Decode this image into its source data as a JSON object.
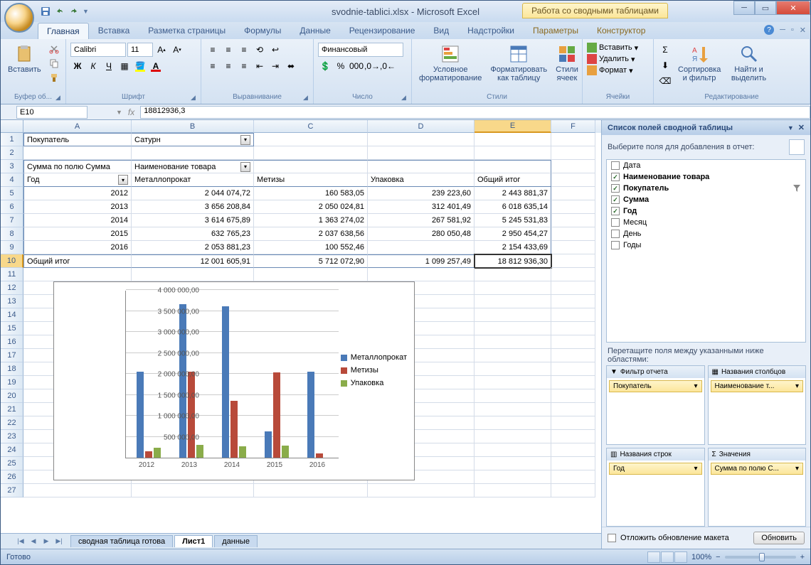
{
  "window": {
    "title": "svodnie-tablici.xlsx - Microsoft Excel",
    "context_tab": "Работа со сводными таблицами"
  },
  "tabs": {
    "home": "Главная",
    "insert": "Вставка",
    "page_layout": "Разметка страницы",
    "formulas": "Формулы",
    "data": "Данные",
    "review": "Рецензирование",
    "view": "Вид",
    "addins": "Надстройки",
    "options": "Параметры",
    "design": "Конструктор"
  },
  "ribbon": {
    "clipboard": {
      "label": "Буфер об...",
      "paste": "Вставить"
    },
    "font": {
      "label": "Шрифт",
      "name": "Calibri",
      "size": "11"
    },
    "alignment": {
      "label": "Выравнивание"
    },
    "number": {
      "label": "Число",
      "format": "Финансовый"
    },
    "styles": {
      "label": "Стили",
      "conditional": "Условное форматирование",
      "format_table": "Форматировать как таблицу",
      "cell_styles": "Стили ячеек"
    },
    "cells": {
      "label": "Ячейки",
      "insert": "Вставить",
      "delete": "Удалить",
      "format": "Формат"
    },
    "editing": {
      "label": "Редактирование",
      "sort": "Сортировка и фильтр",
      "find": "Найти и выделить"
    }
  },
  "formula_bar": {
    "name_box": "E10",
    "formula": "18812936,3"
  },
  "columns": [
    "A",
    "B",
    "C",
    "D",
    "E",
    "F"
  ],
  "pivot": {
    "r1": {
      "label_buyer": "Покупатель",
      "buyer_value": "Сатурн"
    },
    "r3": {
      "sum_label": "Сумма по полю Сумма",
      "col_label": "Наименование товара"
    },
    "r4": {
      "year": "Год",
      "c1": "Металлопрокат",
      "c2": "Метизы",
      "c3": "Упаковка",
      "total": "Общий итог"
    },
    "rows": [
      {
        "year": "2012",
        "c1": "2 044 074,72",
        "c2": "160 583,05",
        "c3": "239 223,60",
        "t": "2 443 881,37"
      },
      {
        "year": "2013",
        "c1": "3 656 208,84",
        "c2": "2 050 024,81",
        "c3": "312 401,49",
        "t": "6 018 635,14"
      },
      {
        "year": "2014",
        "c1": "3 614 675,89",
        "c2": "1 363 274,02",
        "c3": "267 581,92",
        "t": "5 245 531,83"
      },
      {
        "year": "2015",
        "c1": "632 765,23",
        "c2": "2 037 638,56",
        "c3": "280 050,48",
        "t": "2 950 454,27"
      },
      {
        "year": "2016",
        "c1": "2 053 881,23",
        "c2": "100 552,46",
        "c3": "",
        "t": "2 154 433,69"
      }
    ],
    "total_row": {
      "label": "Общий итог",
      "c1": "12 001 605,91",
      "c2": "5 712 072,90",
      "c3": "1 099 257,49",
      "t": "18 812 936,30"
    }
  },
  "chart_data": {
    "type": "bar",
    "categories": [
      "2012",
      "2013",
      "2014",
      "2015",
      "2016"
    ],
    "series": [
      {
        "name": "Металлопрокат",
        "color": "#4a7ab8",
        "values": [
          2044074.72,
          3656208.84,
          3614675.89,
          632765.23,
          2053881.23
        ]
      },
      {
        "name": "Метизы",
        "color": "#b84a3a",
        "values": [
          160583.05,
          2050024.81,
          1363274.02,
          2037638.56,
          100552.46
        ]
      },
      {
        "name": "Упаковка",
        "color": "#8aac4a",
        "values": [
          239223.6,
          312401.49,
          267581.92,
          280050.48,
          0
        ]
      }
    ],
    "ylim": [
      0,
      4000000
    ],
    "y_ticks": [
      "-",
      "500 000,00",
      "1 000 000,00",
      "1 500 000,00",
      "2 000 000,00",
      "2 500 000,00",
      "3 000 000,00",
      "3 500 000,00",
      "4 000 000,00"
    ]
  },
  "sheet_tabs": {
    "t1": "сводная таблица готова",
    "t2": "Лист1",
    "t3": "данные"
  },
  "field_pane": {
    "title": "Список полей сводной таблицы",
    "subtitle": "Выберите поля для добавления в отчет:",
    "fields": [
      {
        "name": "Дата",
        "checked": false
      },
      {
        "name": "Наименование товара",
        "checked": true,
        "bold": true
      },
      {
        "name": "Покупатель",
        "checked": true,
        "bold": true,
        "filtered": true
      },
      {
        "name": "Сумма",
        "checked": true,
        "bold": true
      },
      {
        "name": "Год",
        "checked": true,
        "bold": true
      },
      {
        "name": "Месяц",
        "checked": false
      },
      {
        "name": "День",
        "checked": false
      },
      {
        "name": "Годы",
        "checked": false
      }
    ],
    "drag_label": "Перетащите поля между указанными ниже областями:",
    "zones": {
      "filter": "Фильтр отчета",
      "columns": "Названия столбцов",
      "rows": "Названия строк",
      "values": "Значения"
    },
    "zone_items": {
      "filter": "Покупатель",
      "columns": "Наименование т...",
      "rows": "Год",
      "values": "Сумма по полю С..."
    },
    "defer": "Отложить обновление макета",
    "update": "Обновить"
  },
  "statusbar": {
    "ready": "Готово",
    "zoom": "100%"
  }
}
